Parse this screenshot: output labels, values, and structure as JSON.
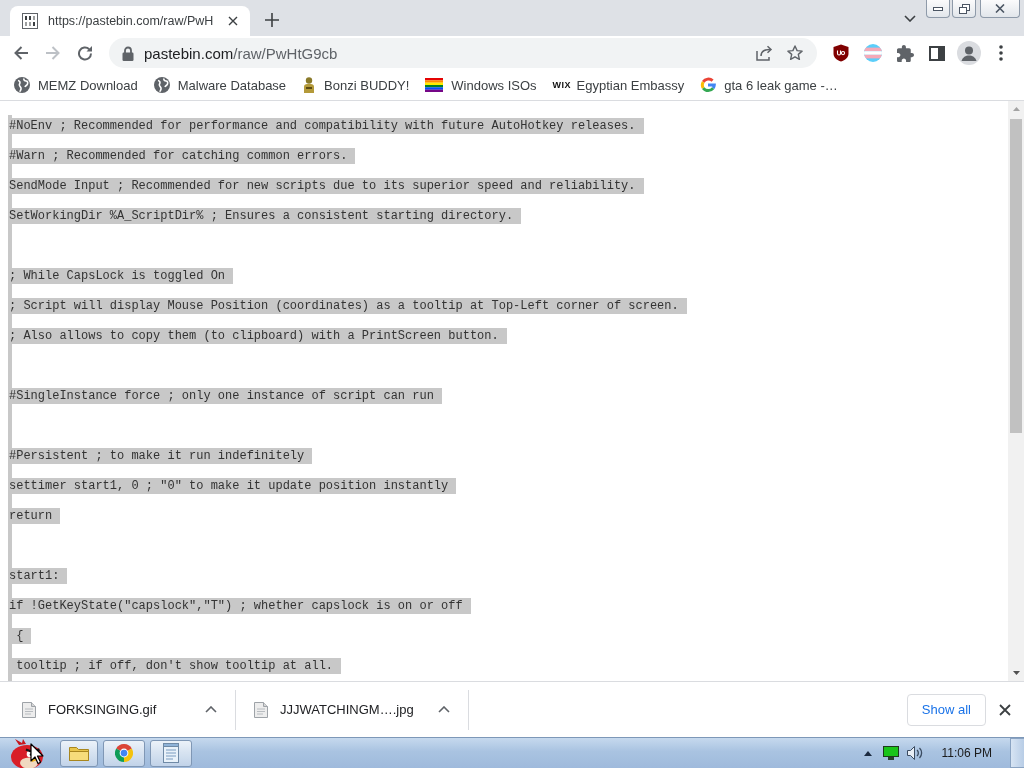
{
  "tabs": [
    {
      "title": "https://pastebin.com/raw/PwH",
      "selected": true
    }
  ],
  "toolbar": {
    "nav_buttons": [
      {
        "kind": "back",
        "disabled": false
      },
      {
        "kind": "forward",
        "disabled": true
      },
      {
        "kind": "reload",
        "disabled": false
      }
    ],
    "address": {
      "domain": "pastebin.com",
      "path": "/raw/PwHtG9cb"
    }
  },
  "bookmarks": [
    {
      "kind": "globe",
      "label": "MEMZ Download"
    },
    {
      "kind": "globe",
      "label": "Malware Database"
    },
    {
      "kind": "figure",
      "label": "Bonzi BUDDY!"
    },
    {
      "kind": "rainbow",
      "label": "Windows ISOs"
    },
    {
      "kind": "wordmark",
      "icon_text": "WIX",
      "label": "Egyptian Embassy"
    },
    {
      "kind": "g",
      "label": "gta 6 leak game -…"
    }
  ],
  "page": {
    "blocks": [
      {
        "lines": [
          "#NoEnv ; Recommended for performance and compatibility with future AutoHotkey releases.",
          "#Warn ; Recommended for catching common errors.",
          "SendMode Input ; Recommended for new scripts due to its superior speed and reliability.",
          "SetWorkingDir %A_ScriptDir% ; Ensures a consistent starting directory."
        ]
      },
      {
        "lines": [
          "; While CapsLock is toggled On",
          "; Script will display Mouse Position (coordinates) as a tooltip at Top-Left corner of screen.",
          "; Also allows to copy them (to clipboard) with a PrintScreen button."
        ]
      },
      {
        "lines": [
          "#SingleInstance force ; only one instance of script can run"
        ]
      },
      {
        "lines": [
          "#Persistent ; to make it run indefinitely",
          "settimer start1, 0 ; \"0\" to make it update position instantly",
          "return"
        ]
      },
      {
        "lines": [
          "start1:",
          "if !GetKeyState(\"capslock\",\"T\") ; whether capslock is on or off",
          " {",
          " tooltip ; if off, don't show tooltip at all."
        ]
      }
    ]
  },
  "downloads": {
    "items": [
      {
        "filename": "FORKSINGING.gif"
      },
      {
        "filename": "JJJWATCHINGM….jpg"
      }
    ],
    "show_all": "Show all"
  },
  "taskbar": {
    "apps": [
      {
        "kind": "folder"
      },
      {
        "kind": "browser"
      },
      {
        "kind": "notepad"
      }
    ],
    "clock": "11:06 PM"
  }
}
